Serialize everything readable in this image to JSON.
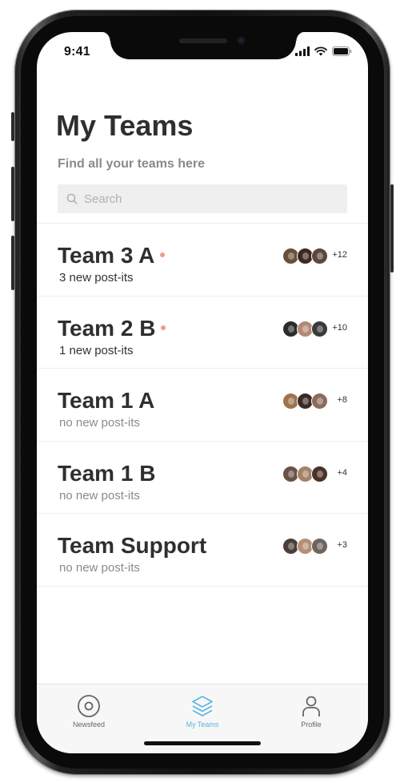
{
  "status": {
    "time": "9:41"
  },
  "header": {
    "title": "My Teams",
    "subtitle": "Find all your teams here"
  },
  "search": {
    "placeholder": "Search",
    "value": ""
  },
  "teams": [
    {
      "name": "Team 3 A",
      "status": "3 new post-its",
      "has_new": true,
      "extra": "+12",
      "avatar_colors": [
        "#6b4e3d",
        "#3e2a22",
        "#5d4740"
      ]
    },
    {
      "name": "Team 2 B",
      "status": "1 new post-its",
      "has_new": true,
      "extra": "+10",
      "avatar_colors": [
        "#2c2c2c",
        "#b38a78",
        "#3a3a3a"
      ]
    },
    {
      "name": "Team 1 A",
      "status": "no new post-its",
      "has_new": false,
      "extra": "+8",
      "avatar_colors": [
        "#a0734f",
        "#3b2a24",
        "#8a6b5c"
      ]
    },
    {
      "name": "Team 1 B",
      "status": "no new post-its",
      "has_new": false,
      "extra": "+4",
      "avatar_colors": [
        "#6a5247",
        "#a48466",
        "#4a3229"
      ]
    },
    {
      "name": "Team Support",
      "status": "no new post-its",
      "has_new": false,
      "extra": "+3",
      "avatar_colors": [
        "#4b3f3a",
        "#b58f76",
        "#6d6460"
      ]
    }
  ],
  "tabbar": {
    "items": [
      {
        "label": "Newsfeed",
        "icon": "target-icon",
        "active": false
      },
      {
        "label": "My Teams",
        "icon": "layers-icon",
        "active": true
      },
      {
        "label": "Profile",
        "icon": "person-icon",
        "active": false
      }
    ]
  },
  "colors": {
    "accent": "#5bb4e0",
    "new_dot": "#ee9b8e",
    "title": "#2f2f2f",
    "muted": "#8a8a8a"
  }
}
